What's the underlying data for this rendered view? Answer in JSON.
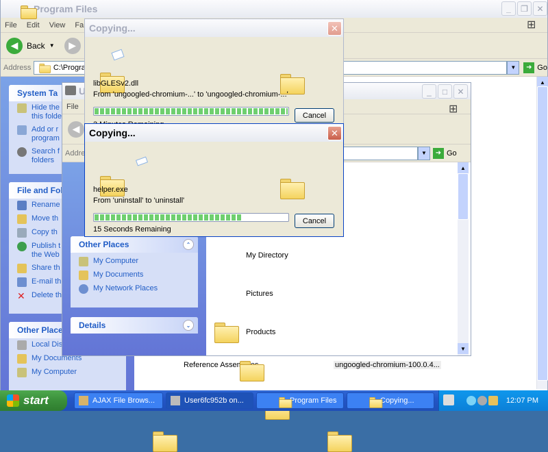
{
  "bg_window": {
    "title": "Program Files",
    "menu": [
      "File",
      "Edit",
      "View",
      "Fa"
    ],
    "back_label": "Back",
    "address_label": "Address",
    "address_value": "C:\\Program",
    "go_label": "Go",
    "panels": [
      {
        "title": "System Ta",
        "items": [
          "Hide the\nthis folde",
          "Add or r\nprogram",
          "Search f\nfolders"
        ]
      },
      {
        "title": "File and Fol",
        "items": [
          "Rename",
          "Move th",
          "Copy th",
          "Publish t\nthe Web",
          "Share th",
          "E-mail th",
          "Delete th"
        ]
      },
      {
        "title": "Other Place",
        "items": [
          "Local Dis",
          "My Documents",
          "My Computer"
        ]
      }
    ],
    "files": [
      "Reference Assemblies",
      "ungoogled-chromium-100.0.4..."
    ]
  },
  "mid_window": {
    "title": "U",
    "menu_first": "File",
    "address_label": "Addre",
    "go_label": "Go",
    "other_places": {
      "title": "Other Places",
      "items": [
        "My Computer",
        "My Documents",
        "My Network Places"
      ]
    },
    "details_title": "Details",
    "folders": [
      "My Directory",
      "Pictures",
      "Products"
    ]
  },
  "copy_dialog_back": {
    "title": "Copying...",
    "filename": "libGLESv2.dll",
    "from_to": "From 'ungoogled-chromium-...' to 'ungoogled-chromium-...'",
    "cancel_label": "Cancel",
    "remaining": "3 Minutes Remaining",
    "progress": 1.0
  },
  "copy_dialog_front": {
    "title": "Copying...",
    "filename": "helper.exe",
    "from_to": "From 'uninstall' to 'uninstall'",
    "cancel_label": "Cancel",
    "remaining": "15 Seconds Remaining",
    "progress": 0.76
  },
  "taskbar": {
    "start_label": "start",
    "buttons": [
      "AJAX File Brows...",
      "User6fc952b on...",
      "Program Files",
      "Copying..."
    ],
    "clock": "12:07 PM"
  }
}
